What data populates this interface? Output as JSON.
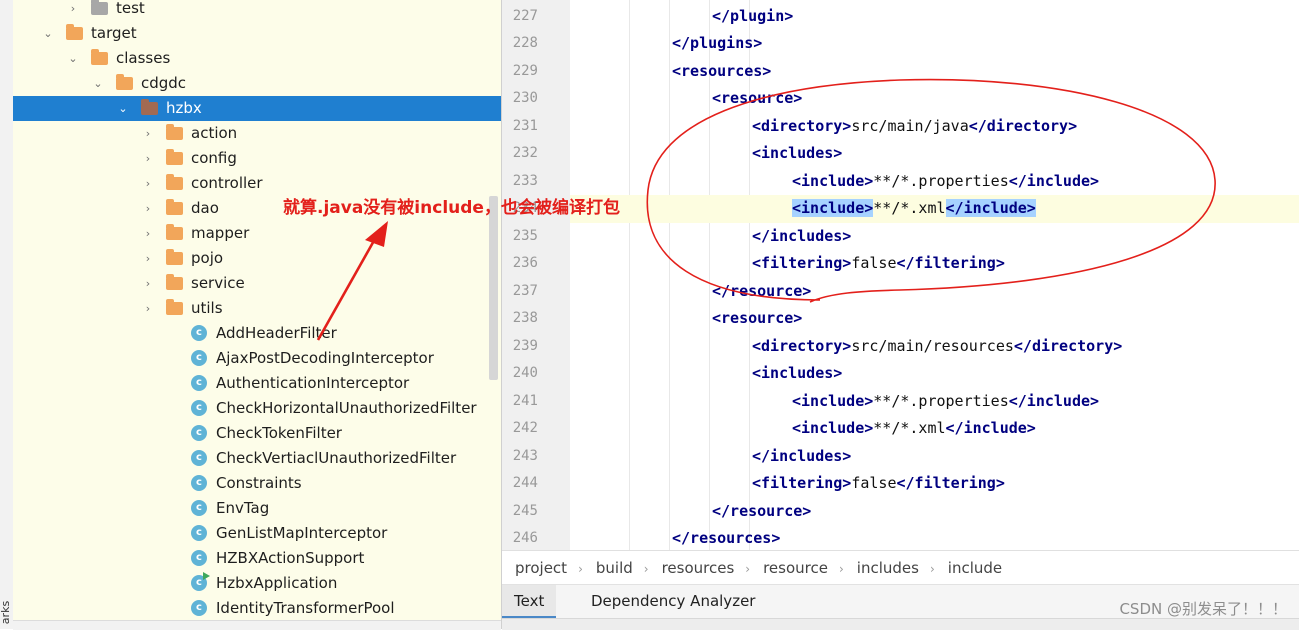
{
  "sidebar": {
    "vertical_label": "arks",
    "tree": [
      {
        "label": "test",
        "kind": "folder-gray",
        "arrow": "›"
      },
      {
        "label": "target",
        "kind": "folder",
        "arrow": "⌄"
      },
      {
        "label": "classes",
        "kind": "folder",
        "arrow": "⌄"
      },
      {
        "label": "cdgdc",
        "kind": "folder",
        "arrow": "⌄"
      },
      {
        "label": "hzbx",
        "kind": "folder-brown",
        "arrow": "⌄",
        "selected": true
      },
      {
        "label": "action",
        "kind": "folder",
        "arrow": "›"
      },
      {
        "label": "config",
        "kind": "folder",
        "arrow": "›"
      },
      {
        "label": "controller",
        "kind": "folder",
        "arrow": "›"
      },
      {
        "label": "dao",
        "kind": "folder",
        "arrow": "›"
      },
      {
        "label": "mapper",
        "kind": "folder",
        "arrow": "›"
      },
      {
        "label": "pojo",
        "kind": "folder",
        "arrow": "›"
      },
      {
        "label": "service",
        "kind": "folder",
        "arrow": "›"
      },
      {
        "label": "utils",
        "kind": "folder",
        "arrow": "›"
      },
      {
        "label": "AddHeaderFilter",
        "kind": "class"
      },
      {
        "label": "AjaxPostDecodingInterceptor",
        "kind": "class"
      },
      {
        "label": "AuthenticationInterceptor",
        "kind": "class"
      },
      {
        "label": "CheckHorizontalUnauthorizedFilter",
        "kind": "class"
      },
      {
        "label": "CheckTokenFilter",
        "kind": "class"
      },
      {
        "label": "CheckVertiaclUnauthorizedFilter",
        "kind": "class"
      },
      {
        "label": "Constraints",
        "kind": "class"
      },
      {
        "label": "EnvTag",
        "kind": "class"
      },
      {
        "label": "GenListMapInterceptor",
        "kind": "class"
      },
      {
        "label": "HZBXActionSupport",
        "kind": "class"
      },
      {
        "label": "HzbxApplication",
        "kind": "class-run"
      },
      {
        "label": "IdentityTransformerPool",
        "kind": "class"
      }
    ]
  },
  "annotation": {
    "text": "就算.java没有被include，也会被编译打包",
    "color": "#e3201b"
  },
  "editor": {
    "lines": [
      {
        "num": "227",
        "indent": 2,
        "parts": [
          [
            "t",
            "</plugin>"
          ]
        ]
      },
      {
        "num": "228",
        "indent": 1,
        "parts": [
          [
            "t",
            "</plugins>"
          ]
        ]
      },
      {
        "num": "229",
        "indent": 1,
        "parts": [
          [
            "t",
            "<resources>"
          ]
        ]
      },
      {
        "num": "230",
        "indent": 2,
        "parts": [
          [
            "t",
            "<resource>"
          ]
        ]
      },
      {
        "num": "231",
        "indent": 3,
        "parts": [
          [
            "t",
            "<directory>"
          ],
          [
            "v",
            "src/main/java"
          ],
          [
            "t",
            "</directory>"
          ]
        ]
      },
      {
        "num": "232",
        "indent": 3,
        "parts": [
          [
            "t",
            "<includes>"
          ]
        ]
      },
      {
        "num": "233",
        "indent": 4,
        "parts": [
          [
            "t",
            "<include>"
          ],
          [
            "v",
            "**/*.properties"
          ],
          [
            "t",
            "</include>"
          ]
        ]
      },
      {
        "num": "234",
        "indent": 4,
        "current": true,
        "parts": [
          [
            "th",
            "<include>"
          ],
          [
            "v",
            "**/*.xml"
          ],
          [
            "th",
            "</include>"
          ]
        ]
      },
      {
        "num": "235",
        "indent": 3,
        "parts": [
          [
            "t",
            "</includes>"
          ]
        ]
      },
      {
        "num": "236",
        "indent": 3,
        "parts": [
          [
            "t",
            "<filtering>"
          ],
          [
            "v",
            "false"
          ],
          [
            "t",
            "</filtering>"
          ]
        ]
      },
      {
        "num": "237",
        "indent": 2,
        "parts": [
          [
            "t",
            "</resource>"
          ]
        ]
      },
      {
        "num": "238",
        "indent": 2,
        "parts": [
          [
            "t",
            "<resource>"
          ]
        ]
      },
      {
        "num": "239",
        "indent": 3,
        "parts": [
          [
            "t",
            "<directory>"
          ],
          [
            "v",
            "src/main/resources"
          ],
          [
            "t",
            "</directory>"
          ]
        ]
      },
      {
        "num": "240",
        "indent": 3,
        "parts": [
          [
            "t",
            "<includes>"
          ]
        ]
      },
      {
        "num": "241",
        "indent": 4,
        "parts": [
          [
            "t",
            "<include>"
          ],
          [
            "v",
            "**/*.properties"
          ],
          [
            "t",
            "</include>"
          ]
        ]
      },
      {
        "num": "242",
        "indent": 4,
        "parts": [
          [
            "t",
            "<include>"
          ],
          [
            "v",
            "**/*.xml"
          ],
          [
            "t",
            "</include>"
          ]
        ]
      },
      {
        "num": "243",
        "indent": 3,
        "parts": [
          [
            "t",
            "</includes>"
          ]
        ]
      },
      {
        "num": "244",
        "indent": 3,
        "parts": [
          [
            "t",
            "<filtering>"
          ],
          [
            "v",
            "false"
          ],
          [
            "t",
            "</filtering>"
          ]
        ]
      },
      {
        "num": "245",
        "indent": 2,
        "parts": [
          [
            "t",
            "</resource>"
          ]
        ]
      },
      {
        "num": "246",
        "indent": 1,
        "parts": [
          [
            "t",
            "</resources>"
          ]
        ]
      }
    ]
  },
  "breadcrumb": [
    "project",
    "build",
    "resources",
    "resource",
    "includes",
    "include"
  ],
  "breadcrumb_sep": "›",
  "tabs": [
    {
      "label": "Text",
      "active": true
    },
    {
      "label": "Dependency Analyzer",
      "active": false
    }
  ],
  "watermark": "CSDN @别发呆了！！！",
  "colors": {
    "tree_bg": "#fdfde9",
    "selection": "#1f7fd0",
    "tag": "#000080",
    "highlight": "#a6d2ff",
    "annotation": "#e3201b"
  }
}
